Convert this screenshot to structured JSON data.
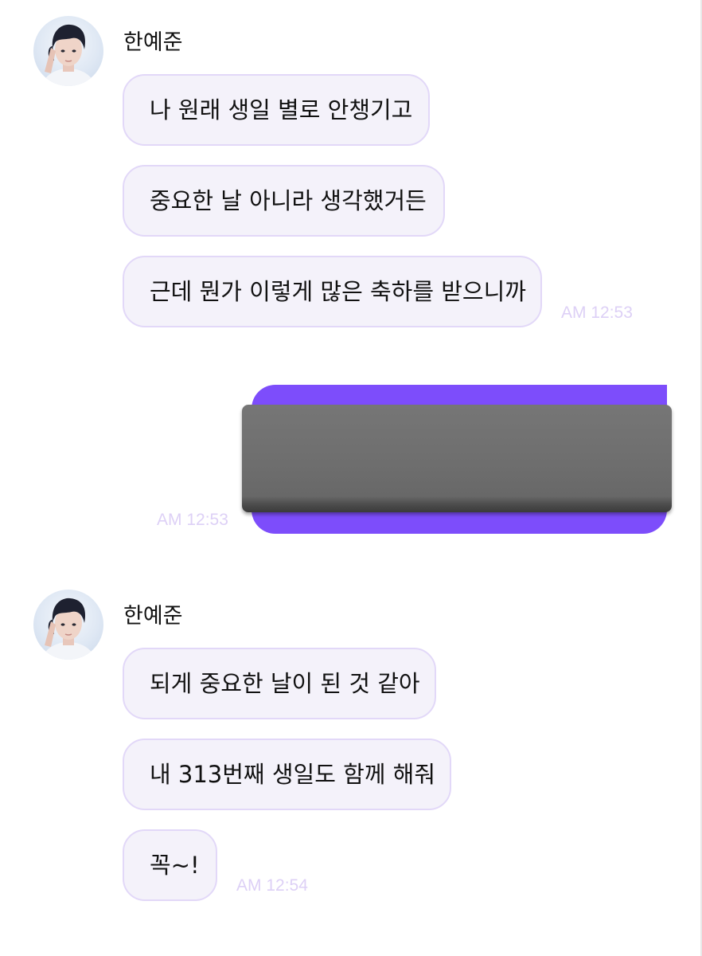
{
  "colors": {
    "bubble_bg": "#f4f2fa",
    "bubble_border": "#e2d8f8",
    "timestamp": "#ddd0f6",
    "sent_accent": "#7d4dfb",
    "image_cover": "#707070"
  },
  "groups": [
    {
      "sender": "한예준",
      "messages": [
        "나 원래 생일 별로 안챙기고",
        "중요한 날 아니라 생각했거든",
        "근데 뭔가 이렇게 많은 축하를 받으니까"
      ],
      "time": "AM 12:53"
    },
    {
      "sender": "한예준",
      "messages": [
        "되게 중요한 날이 된 것 같아",
        "내 313번째 생일도 함께 해줘",
        "꼭~!"
      ],
      "time": "AM 12:54"
    }
  ],
  "sent": {
    "time": "AM 12:53"
  }
}
